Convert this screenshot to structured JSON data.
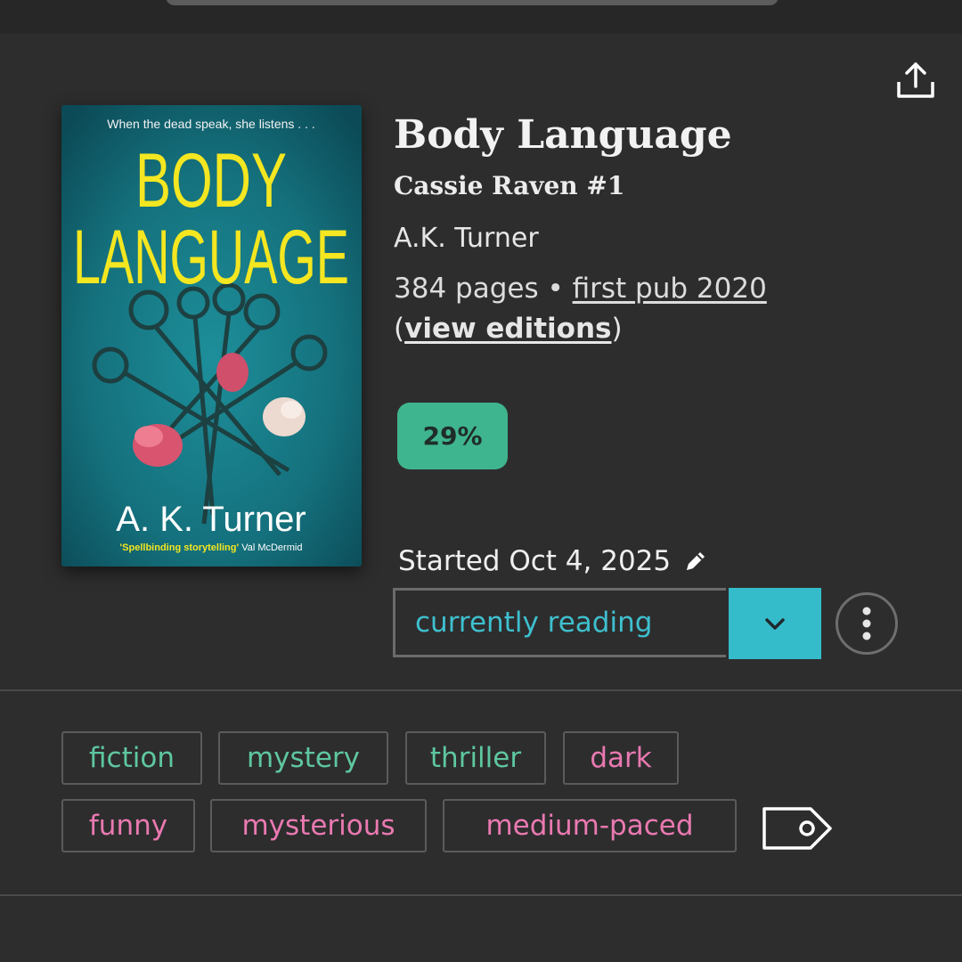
{
  "book": {
    "cover": {
      "tagline": "When the dead speak, she listens . . .",
      "title_line1": "BODY",
      "title_line2": "LANGUAGE",
      "author": "A. K. Turner",
      "quote": "'Spellbinding storytelling'",
      "quote_by": "Val McDermid"
    },
    "title": "Body Language",
    "series": "Cassie Raven #1",
    "author": "A.K. Turner",
    "pages": "384 pages",
    "separator": " • ",
    "first_pub": "first pub 2020",
    "editions_open": "(",
    "editions_label": "view editions",
    "editions_close": ")"
  },
  "progress": {
    "label": "29%",
    "value": 29,
    "color": "#3fb58f"
  },
  "reading": {
    "started_label": "Started Oct 4, 2025",
    "status": "currently reading",
    "status_color": "#35bccb"
  },
  "tags": {
    "genres": [
      "fiction",
      "mystery",
      "thriller"
    ],
    "moods": [
      "dark",
      "funny",
      "mysterious",
      "medium-paced"
    ],
    "genre_color": "#5ec7a0",
    "mood_color": "#ea79b1"
  },
  "icons": {
    "share": "share-icon",
    "edit": "pencil-icon",
    "dropdown": "chevron-down-icon",
    "more": "more-vertical-icon",
    "tag": "tag-icon"
  }
}
